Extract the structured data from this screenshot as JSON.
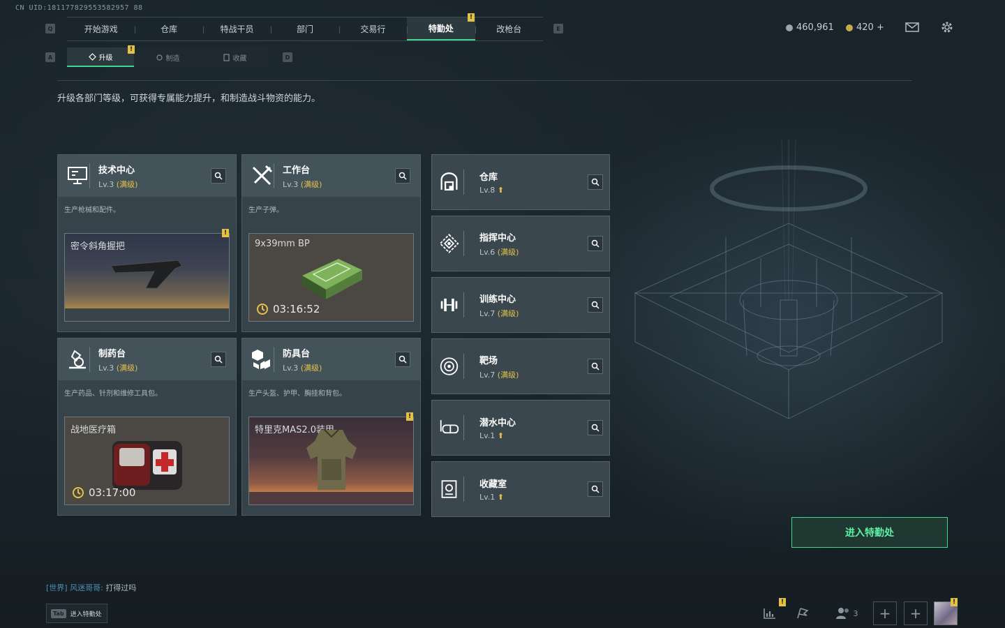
{
  "uid": "CN UID:181177829553582957 88",
  "nav": {
    "tabs": [
      "开始游戏",
      "仓库",
      "特战干员",
      "部门",
      "交易行",
      "特勤处",
      "改枪台"
    ],
    "left_key": "Q",
    "right_key": "E"
  },
  "resources": {
    "silver": "460,961",
    "gold": "420 +"
  },
  "subnav": {
    "tabs": [
      "升级",
      "制造",
      "收藏"
    ],
    "left_key": "A",
    "right_key": "D"
  },
  "description": "升级各部门等级，可获得专属能力提升，和制造战斗物资的能力。",
  "cards": [
    {
      "name": "技术中心",
      "lv": "Lv.3",
      "max": "(满级)",
      "sub": "生产枪械和配件。",
      "product": "密令斜角握把",
      "timer": ""
    },
    {
      "name": "工作台",
      "lv": "Lv.3",
      "max": "(满级)",
      "sub": "生产子弹。",
      "product": "9x39mm BP",
      "timer": "03:16:52"
    },
    {
      "name": "制药台",
      "lv": "Lv.3",
      "max": "(满级)",
      "sub": "生产药品、针剂和维修工具包。",
      "product": "战地医疗箱",
      "timer": "03:17:00"
    },
    {
      "name": "防具台",
      "lv": "Lv.3",
      "max": "(满级)",
      "sub": "生产头盔、护甲、胸挂和背包。",
      "product": "特里克MAS2.0装甲",
      "timer": ""
    }
  ],
  "rooms": [
    {
      "name": "仓库",
      "lv": "Lv.8",
      "max": ""
    },
    {
      "name": "指挥中心",
      "lv": "Lv.6",
      "max": "(满级)"
    },
    {
      "name": "训练中心",
      "lv": "Lv.7",
      "max": "(满级)"
    },
    {
      "name": "靶场",
      "lv": "Lv.7",
      "max": "(满级)"
    },
    {
      "name": "潜水中心",
      "lv": "Lv.1",
      "max": ""
    },
    {
      "name": "收藏室",
      "lv": "Lv.1",
      "max": ""
    }
  ],
  "enter_button": "进入特勤处",
  "chat": {
    "channel": "[世界]",
    "user": "风迷哥哥:",
    "message": "打得过吗"
  },
  "bottom": {
    "tab_key": "Tab",
    "tab_label": "进入特勤处",
    "squad_count": "3"
  },
  "alert_mark": "!",
  "colors": {
    "accent": "#3dd98f",
    "max_level": "#e4c14a",
    "alert": "#e2c146"
  }
}
